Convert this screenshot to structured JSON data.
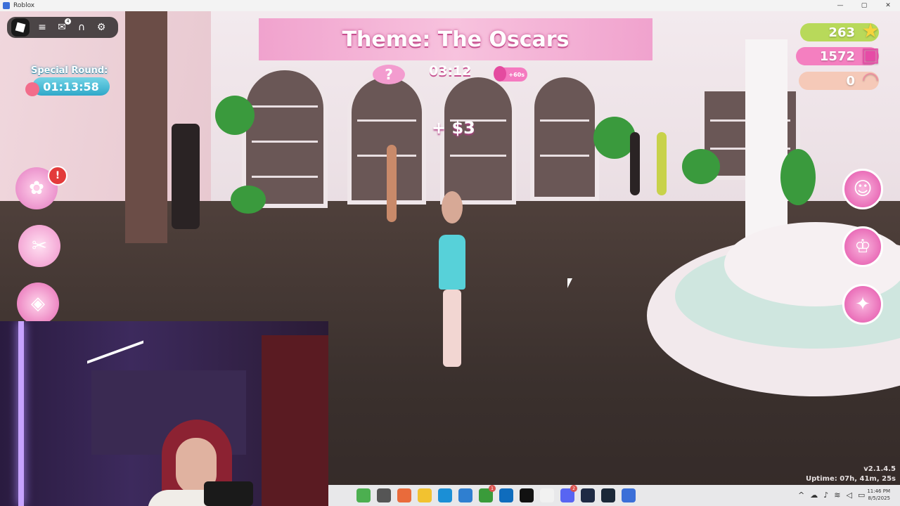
{
  "window": {
    "title": "Roblox",
    "controls": {
      "minimize": "—",
      "maximize": "▢",
      "close": "✕"
    }
  },
  "hud": {
    "theme": "Theme: The Oscars",
    "timer": "03:12",
    "bonus": "+60s",
    "mystery": "?",
    "money_pop": "+ $3",
    "special_round": {
      "label": "Special Round:",
      "time": "01:13:58"
    },
    "stats": [
      {
        "value": "263",
        "icon": "star-icon",
        "color": "#b8d95a"
      },
      {
        "value": "1572",
        "icon": "gift-icon",
        "color": "#f47fc0"
      },
      {
        "value": "0",
        "icon": "shell-icon",
        "color": "#f5c9b8"
      }
    ],
    "alert": "!",
    "version": "v2.1.4.5",
    "uptime": "Uptime: 07h, 41m, 25s"
  },
  "roblox_menu": {
    "items": [
      "roblox-logo-icon",
      "hamburger-menu-icon",
      "chat-icon",
      "headset-icon",
      "settings-icon"
    ],
    "chat_badge": "4"
  },
  "colors": {
    "accent_pink": "#f57ac0",
    "hud_teal": "#2fa8c9",
    "banner_text_shadow": "#c64f8f"
  },
  "taskbar": {
    "apps": [
      {
        "name": "widgets-icon",
        "color": "#4caf50",
        "badge": ""
      },
      {
        "name": "task-view-icon",
        "color": "#555555",
        "badge": ""
      },
      {
        "name": "copilot-icon",
        "color": "#e96b3b",
        "badge": ""
      },
      {
        "name": "file-explorer-icon",
        "color": "#f2c230",
        "badge": ""
      },
      {
        "name": "edge-icon",
        "color": "#1b8fd6",
        "badge": ""
      },
      {
        "name": "store-icon",
        "color": "#2f7fd0",
        "badge": ""
      },
      {
        "name": "xbox-icon",
        "color": "#3a9b3a",
        "badge": "1"
      },
      {
        "name": "outlook-icon",
        "color": "#0f6cbd",
        "badge": ""
      },
      {
        "name": "tiktok-icon",
        "color": "#111111",
        "badge": ""
      },
      {
        "name": "notepad-icon",
        "color": "#f1f1f1",
        "badge": ""
      },
      {
        "name": "discord-icon",
        "color": "#5865f2",
        "badge": "2"
      },
      {
        "name": "terminal-icon",
        "color": "#1f2a44",
        "badge": ""
      },
      {
        "name": "steam-icon",
        "color": "#1b2838",
        "badge": ""
      },
      {
        "name": "roblox-taskbar-icon",
        "color": "#3b6fd8",
        "badge": ""
      }
    ],
    "tray": [
      "chevron-up-icon",
      "cloud-icon",
      "microphone-icon",
      "wifi-icon",
      "volume-icon",
      "battery-icon"
    ],
    "time": "11:46 PM",
    "date": "8/5/2025"
  }
}
